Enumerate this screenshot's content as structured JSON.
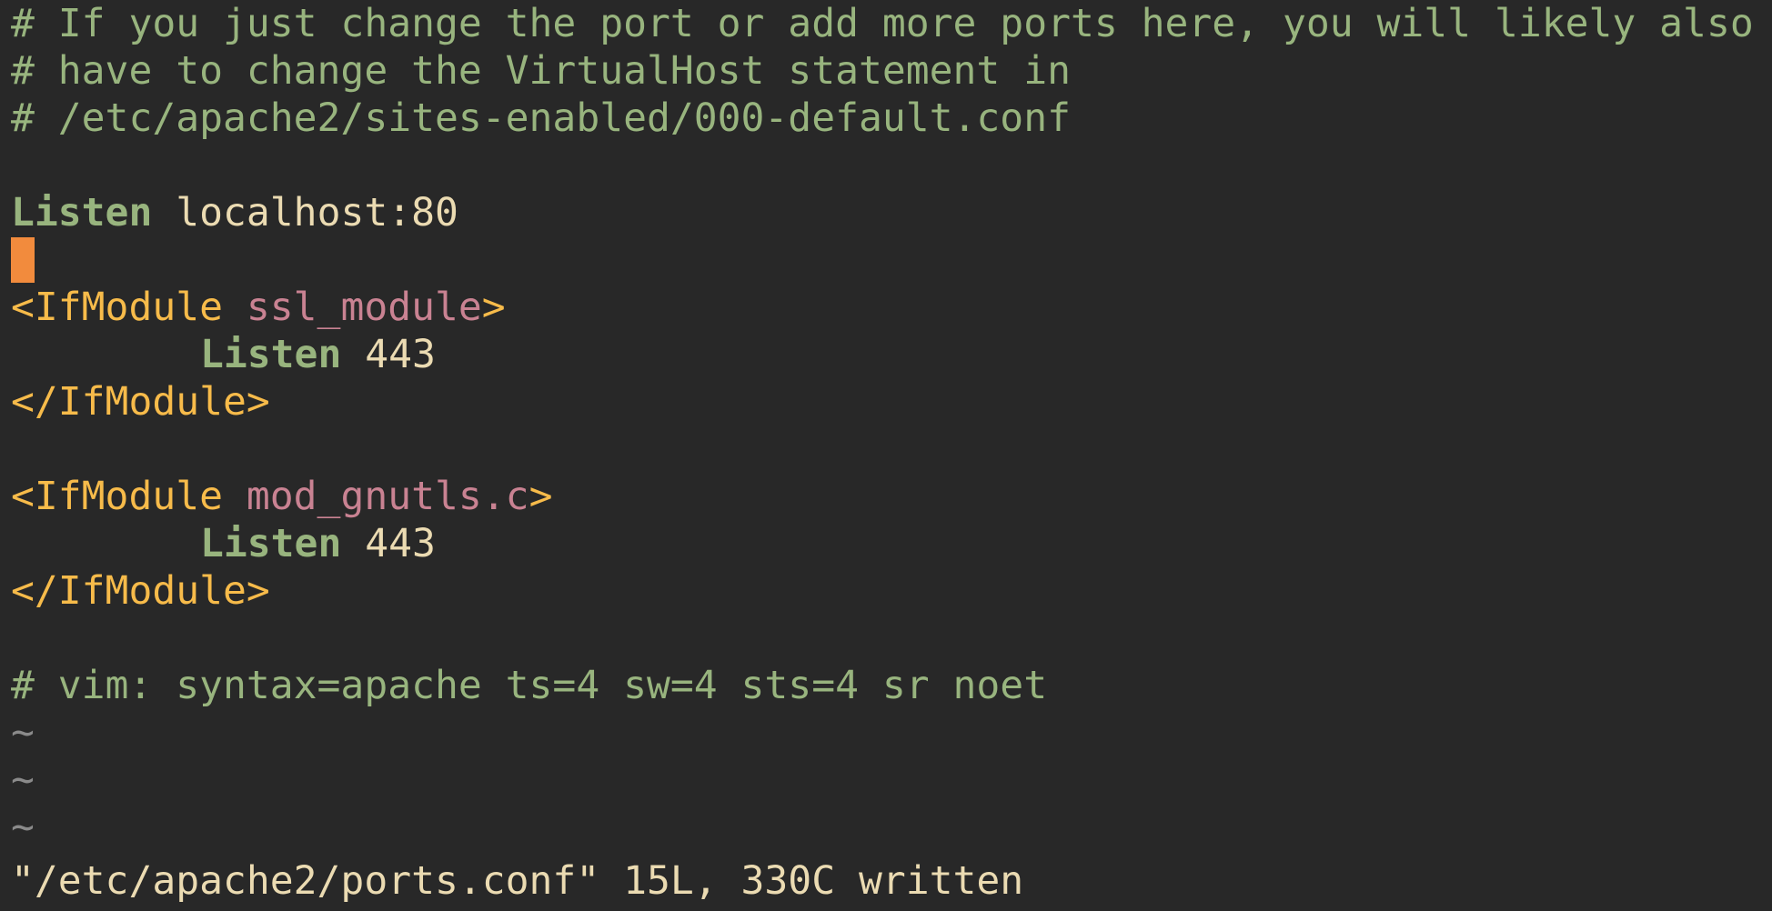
{
  "editor": {
    "comments": {
      "line1": "# If you just change the port or add more ports here, you will likely also",
      "line2": "# have to change the VirtualHost statement in",
      "line3": "# /etc/apache2/sites-enabled/000-default.conf",
      "modeline": "# vim: syntax=apache ts=4 sw=4 sts=4 sr noet"
    },
    "listen_main": {
      "keyword": "Listen",
      "value": "localhost:80"
    },
    "block_ssl": {
      "open_prefix": "<IfModule",
      "module": "ssl_module",
      "open_suffix": ">",
      "keyword": "Listen",
      "value": "443",
      "close": "</IfModule>"
    },
    "block_gnutls": {
      "open_prefix": "<IfModule",
      "module": "mod_gnutls.c",
      "open_suffix": ">",
      "keyword": "Listen",
      "value": "443",
      "close": "</IfModule>"
    },
    "empty_line_marker": "~",
    "status_message": "\"/etc/apache2/ports.conf\" 15L, 330C written"
  },
  "colors": {
    "background": "#282828",
    "comment": "#98b47e",
    "tag": "#f7bb4a",
    "module": "#c98292",
    "cursor": "#f28b3d",
    "text": "#ebdbb2"
  }
}
